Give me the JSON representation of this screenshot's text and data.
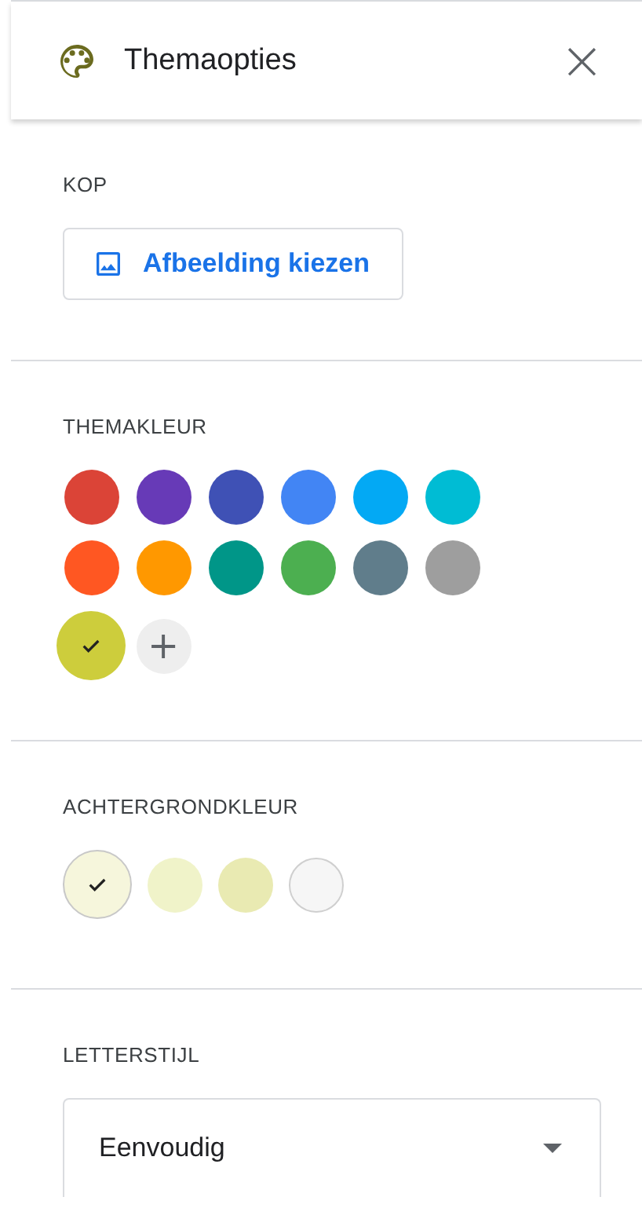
{
  "header": {
    "title": "Themaopties",
    "close": "×"
  },
  "header_section": {
    "label": "KOP",
    "button": "Afbeelding kiezen"
  },
  "theme_color": {
    "label": "THEMAKLEUR",
    "swatches": [
      {
        "kind": "color",
        "color": "#db4437",
        "selected": false
      },
      {
        "kind": "color",
        "color": "#673ab7",
        "selected": false
      },
      {
        "kind": "color",
        "color": "#3f51b5",
        "selected": false
      },
      {
        "kind": "color",
        "color": "#4285f4",
        "selected": false
      },
      {
        "kind": "color",
        "color": "#03a9f4",
        "selected": false
      },
      {
        "kind": "color",
        "color": "#00bcd4",
        "selected": false
      },
      {
        "kind": "color",
        "color": "#ff5722",
        "selected": false
      },
      {
        "kind": "color",
        "color": "#ff9800",
        "selected": false
      },
      {
        "kind": "color",
        "color": "#009688",
        "selected": false
      },
      {
        "kind": "color",
        "color": "#4caf50",
        "selected": false
      },
      {
        "kind": "color",
        "color": "#607d8b",
        "selected": false
      },
      {
        "kind": "color",
        "color": "#9e9e9e",
        "selected": false
      },
      {
        "kind": "color",
        "color": "#cdcd3c",
        "selected": true
      },
      {
        "kind": "add",
        "label": "+"
      }
    ]
  },
  "background_color": {
    "label": "ACHTERGRONDKLEUR",
    "swatches": [
      {
        "color": "#f6f6dc",
        "selected": true
      },
      {
        "color": "#f0f3c9",
        "selected": false
      },
      {
        "color": "#e9eab2",
        "selected": false
      },
      {
        "color": "#f6f6f6",
        "selected": false
      }
    ]
  },
  "font_style": {
    "label": "LETTERSTIJL",
    "value": "Eenvoudig"
  }
}
